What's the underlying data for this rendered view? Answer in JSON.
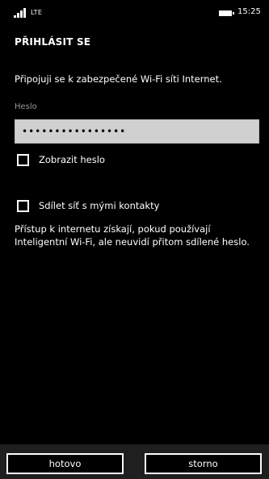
{
  "status_bar": {
    "network": "LTE",
    "time": "15:25",
    "icons": [
      "signal-icon",
      "battery-icon"
    ]
  },
  "page": {
    "title": "PŘIHLÁSIT SE",
    "message": "Připojuji se k zabezpečené Wi-Fi síti Internet."
  },
  "password": {
    "label": "Heslo",
    "value": "••••••••••••••••"
  },
  "show_password": {
    "label": "Zobrazit heslo",
    "checked": false
  },
  "share_network": {
    "label": "Sdílet síť s mými kontakty",
    "checked": false,
    "info": "Přístup k internetu získají, pokud používají Inteligentní Wi-Fi, ale neuvidí přitom sdílené heslo."
  },
  "app_bar": {
    "done_label": "hotovo",
    "cancel_label": "storno"
  }
}
